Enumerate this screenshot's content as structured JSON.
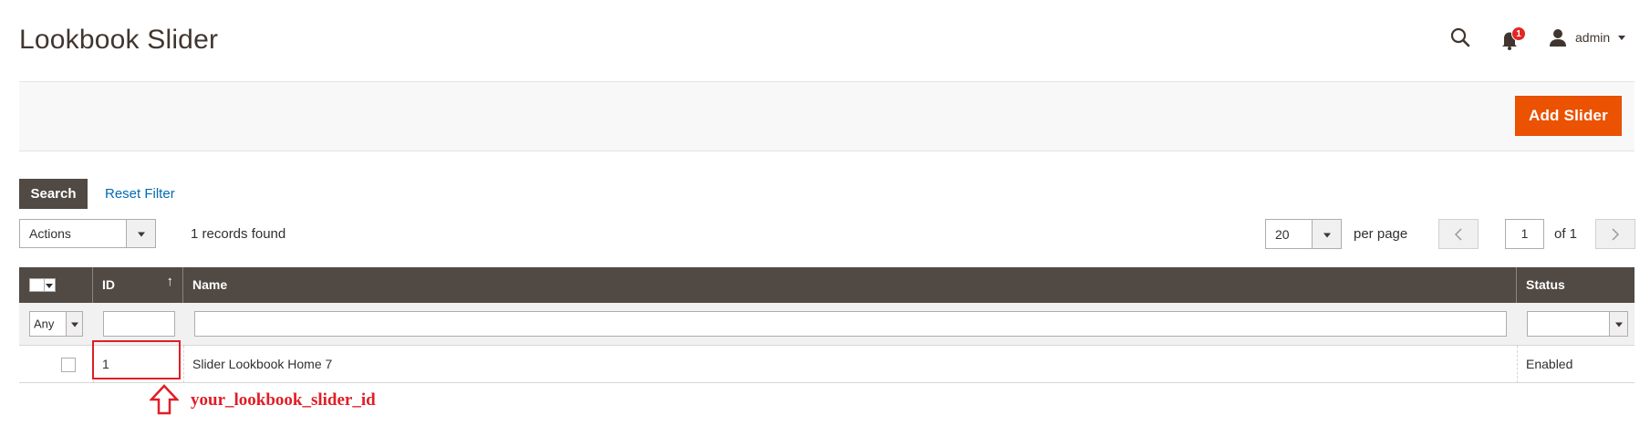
{
  "header": {
    "title": "Lookbook Slider",
    "notification_count": "1",
    "user_name": "admin",
    "icons": {
      "search": "search-icon",
      "notifications": "bell-icon",
      "user": "user-icon"
    }
  },
  "page_actions": {
    "add_button": "Add Slider"
  },
  "toolbar": {
    "search_button": "Search",
    "reset_filter": "Reset Filter",
    "mass_actions": {
      "selected": "Actions"
    },
    "records_found": "1 records found",
    "per_page_value": "20",
    "per_page_label": "per page",
    "current_page": "1",
    "page_total": "of 1"
  },
  "grid": {
    "columns": [
      "ID",
      "Name",
      "Status"
    ],
    "sort_indicator": "↑",
    "filters": {
      "mass_select": "Any",
      "id": "",
      "name": "",
      "status": ""
    },
    "rows": [
      {
        "id": "1",
        "name": "Slider Lookbook Home 7",
        "status": "Enabled"
      }
    ]
  },
  "annotation": {
    "text": "your_lookbook_slider_id",
    "color": "#e01e26"
  },
  "colors": {
    "accent": "#eb5202",
    "grid_header": "#514943",
    "link": "#006bb4",
    "badge": "#e22626"
  }
}
